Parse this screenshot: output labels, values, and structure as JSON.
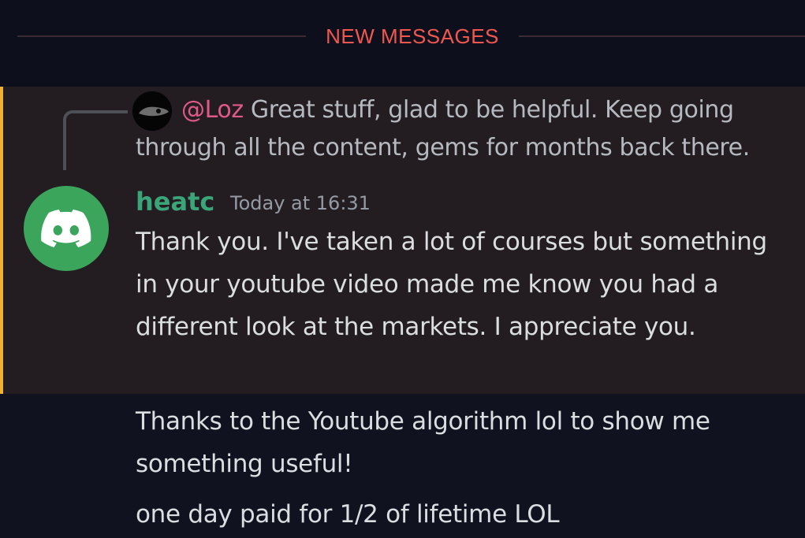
{
  "divider": {
    "label": "NEW MESSAGES",
    "color": "#f0584f"
  },
  "reply": {
    "mention": "@Loz",
    "text": "Great stuff, glad to be helpful.  Keep going through all the content, gems for months back there.",
    "avatar_icon": "dark-avatar-icon"
  },
  "message": {
    "author": "heatc",
    "author_color": "#3ba57a",
    "timestamp": "Today at 16:31",
    "avatar_icon": "discord-logo-icon",
    "avatar_color": "#3ba55c",
    "text": "Thank you. I've taken a lot of courses but something in your youtube video made me know you had a different look at the markets.  I appreciate you."
  },
  "followups": [
    {
      "text": "Thanks to the Youtube algorithm lol to show me something useful!"
    },
    {
      "text": "one day paid for 1/2 of lifetime LOL"
    }
  ]
}
